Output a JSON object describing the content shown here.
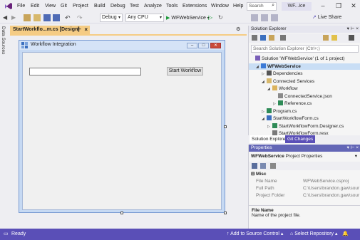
{
  "menu": {
    "items": [
      "File",
      "Edit",
      "View",
      "Git",
      "Project",
      "Build",
      "Debug",
      "Test",
      "Analyze",
      "Tools",
      "Extensions",
      "Window",
      "Help"
    ],
    "search_placeholder": "Search",
    "title": "WF...ice"
  },
  "toolbar": {
    "config": "Debug",
    "platform": "Any CPU",
    "run_target": "WFWebService",
    "live_share": "Live Share"
  },
  "sidebar": {
    "data_sources": "Data Sources"
  },
  "editor": {
    "tab_label": "StartWorkflo...m.cs [Design]",
    "form_title": "Workflow Integration",
    "input_value": "",
    "start_button": "Start Workflow"
  },
  "solution_explorer": {
    "header": "Solution Explorer",
    "search_placeholder": "Search Solution Explorer (Ctrl+;)",
    "tree": [
      {
        "label": "Solution 'WFWebService' (1 of 1 project)",
        "indent": 0,
        "icon": "solution-icon",
        "selected": false,
        "expander": ""
      },
      {
        "label": "WFWebService",
        "indent": 1,
        "icon": "web-project-icon",
        "selected": true,
        "expander": "◢",
        "bold": true
      },
      {
        "label": "Dependencies",
        "indent": 2,
        "icon": "dependencies-icon",
        "selected": false,
        "expander": "▷"
      },
      {
        "label": "Connected Services",
        "indent": 2,
        "icon": "connected-services-icon",
        "selected": false,
        "expander": "◢"
      },
      {
        "label": "Workflow",
        "indent": 3,
        "icon": "folder-icon",
        "selected": false,
        "expander": "◢"
      },
      {
        "label": "ConnectedService.json",
        "indent": 4,
        "icon": "json-file-icon",
        "selected": false,
        "expander": ""
      },
      {
        "label": "Reference.cs",
        "indent": 4,
        "icon": "csharp-file-icon",
        "selected": false,
        "expander": "▷"
      },
      {
        "label": "Program.cs",
        "indent": 2,
        "icon": "csharp-file-icon",
        "selected": false,
        "expander": "▷"
      },
      {
        "label": "StartWorkflowForm.cs",
        "indent": 2,
        "icon": "form-file-icon",
        "selected": false,
        "expander": "◢"
      },
      {
        "label": "StartWorkflowForm.Designer.cs",
        "indent": 3,
        "icon": "csharp-file-icon",
        "selected": false,
        "expander": "▷"
      },
      {
        "label": "StartWorkflowForm.resx",
        "indent": 3,
        "icon": "resx-file-icon",
        "selected": false,
        "expander": ""
      }
    ],
    "tabs": [
      "Solution Explorer",
      "Git Changes"
    ]
  },
  "properties": {
    "header": "Properties",
    "object_name": "WFWebService",
    "object_type": "Project Properties",
    "category": "Misc",
    "rows": [
      {
        "key": "File Name",
        "value": "WFWebService.csproj"
      },
      {
        "key": "Full Path",
        "value": "C:\\Users\\brandon.gaw\\sour"
      },
      {
        "key": "Project Folder",
        "value": "C:\\Users\\brandon.gaw\\sour"
      }
    ],
    "desc_title": "File Name",
    "desc_text": "Name of the project file."
  },
  "status": {
    "ready": "Ready",
    "source_control": "Add to Source Control",
    "repository": "Select Repository"
  },
  "colors": {
    "accent": "#5a4fb7",
    "tab_active": "#f5cc84",
    "selection": "#c9def5"
  }
}
